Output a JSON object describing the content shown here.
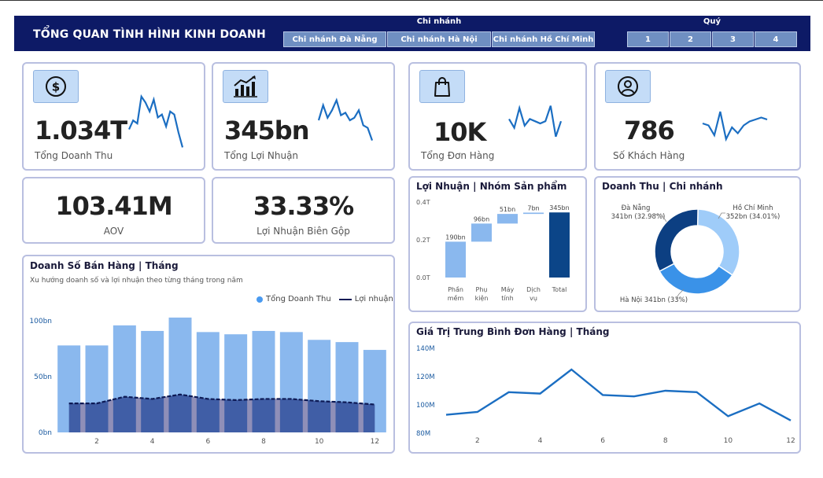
{
  "header": {
    "title": "TỔNG QUAN TÌNH HÌNH KINH DOANH",
    "branch_slicer_title": "Chi nhánh",
    "branches": [
      "Chi nhánh Đà Nẵng",
      "Chi nhánh Hà Nội",
      "Chi nhánh Hồ Chí Minh"
    ],
    "quarter_slicer_title": "Quý",
    "quarters": [
      "1",
      "2",
      "3",
      "4"
    ]
  },
  "kpis": [
    {
      "value": "1.034T",
      "label": "Tổng Doanh Thu",
      "icon": "dollar-icon",
      "spark": [
        40,
        55,
        50,
        95,
        85,
        70,
        90,
        60,
        65,
        45,
        70,
        65,
        35,
        10
      ]
    },
    {
      "value": "345bn",
      "label": "Tổng Lợi Nhuận",
      "icon": "bar-chart-icon",
      "spark": [
        50,
        80,
        55,
        70,
        90,
        60,
        65,
        50,
        55,
        70,
        40,
        35,
        10
      ]
    },
    {
      "value": "10K",
      "label": "Tổng Đơn Hàng",
      "icon": "shopping-bag-icon",
      "spark": [
        60,
        40,
        85,
        45,
        60,
        55,
        50,
        55,
        90,
        20,
        55
      ]
    },
    {
      "value": "786",
      "label": "Số Khách Hàng",
      "icon": "user-icon",
      "spark": [
        60,
        55,
        30,
        90,
        20,
        50,
        35,
        55,
        65,
        70,
        75,
        70
      ]
    }
  ],
  "metrics": [
    {
      "value": "103.41M",
      "label": "AOV"
    },
    {
      "value": "33.33%",
      "label": "Lợi Nhuận Biên Gộp"
    }
  ],
  "sales_card": {
    "title": "Doanh Số Bán Hàng | Tháng",
    "subtitle": "Xu hướng doanh số và lợi nhuận theo từng tháng trong năm",
    "legend_revenue": "Tổng Doanh Thu",
    "legend_profit": "Lợi nhuận"
  },
  "profit_card": {
    "title": "Lợi Nhuận | Nhóm Sản phẩm"
  },
  "donut_card": {
    "title": "Doanh Thu | Chi nhánh"
  },
  "aov_card": {
    "title": "Giá Trị Trung Bình Đơn Hàng | Tháng"
  },
  "colors": {
    "navy": "#0d1a66",
    "bar_light": "#8ab8ee",
    "line_blue": "#1b6ec2",
    "dark_blue": "#0b4588"
  },
  "chart_data": [
    {
      "type": "bar",
      "name": "monthly-sales",
      "x": [
        1,
        2,
        3,
        4,
        5,
        6,
        7,
        8,
        9,
        10,
        11,
        12
      ],
      "x_ticks": [
        "2",
        "4",
        "6",
        "8",
        "10",
        "12"
      ],
      "y_ticks": [
        "0bn",
        "50bn",
        "100bn"
      ],
      "ylim": [
        0,
        110
      ],
      "series": [
        {
          "name": "Tổng Doanh Thu",
          "type": "bar",
          "values": [
            78,
            78,
            96,
            91,
            103,
            90,
            88,
            91,
            90,
            83,
            81,
            74
          ]
        },
        {
          "name": "Lợi nhuận",
          "type": "area-line",
          "values": [
            26,
            26,
            32,
            30,
            34,
            30,
            29,
            30,
            30,
            28,
            27,
            25
          ]
        }
      ]
    },
    {
      "type": "waterfall",
      "name": "profit-by-category",
      "categories": [
        "Phần mềm",
        "Phụ kiện",
        "Máy tính",
        "Dịch vụ",
        "Total"
      ],
      "values": [
        190,
        96,
        51,
        7,
        345
      ],
      "labels": [
        "190bn",
        "96bn",
        "51bn",
        "7bn",
        "345bn"
      ],
      "y_ticks": [
        "0.0T",
        "0.2T",
        "0.4T"
      ],
      "ylim": [
        0,
        400
      ]
    },
    {
      "type": "pie",
      "name": "revenue-by-branch",
      "slices": [
        {
          "name": "Hồ Chí Minh",
          "value": 352,
          "label": "352bn (34.01%)",
          "color": "#9fccf9"
        },
        {
          "name": "Hà Nội",
          "value": 341,
          "label": "Hà Nội 341bn (33%)",
          "color": "#3a92e8"
        },
        {
          "name": "Đà Nẵng",
          "value": 341,
          "label": "341bn (32.98%)",
          "color": "#0c3f82"
        }
      ]
    },
    {
      "type": "line",
      "name": "aov-by-month",
      "x": [
        1,
        2,
        3,
        4,
        5,
        6,
        7,
        8,
        9,
        10,
        11,
        12
      ],
      "values": [
        93,
        95,
        109,
        108,
        125,
        107,
        106,
        110,
        109,
        92,
        101,
        89
      ],
      "x_ticks": [
        "2",
        "4",
        "6",
        "8",
        "10",
        "12"
      ],
      "y_ticks": [
        "80M",
        "100M",
        "120M",
        "140M"
      ],
      "ylim": [
        80,
        140
      ]
    }
  ]
}
